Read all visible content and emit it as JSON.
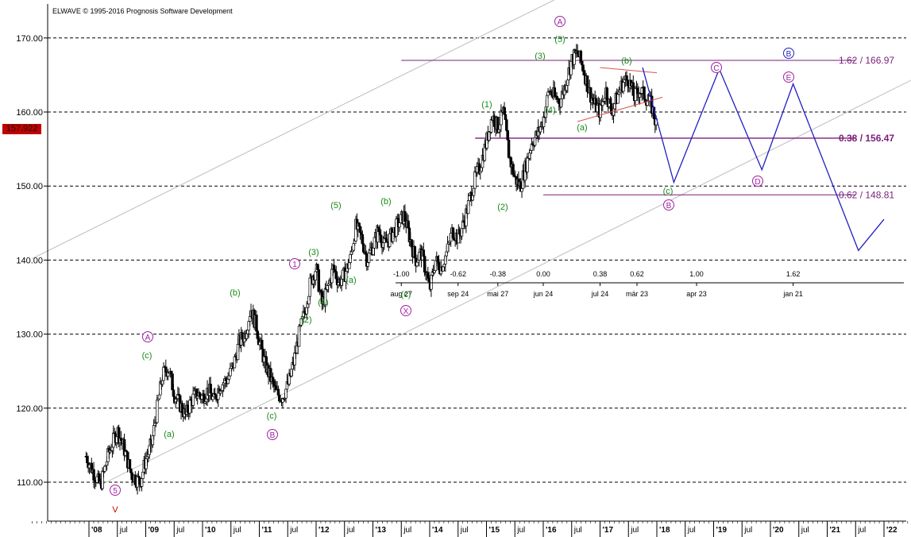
{
  "header": {
    "copyright": "ELWAVE © 1995-2016 Prognosis Software Development",
    "current_price": "157.922"
  },
  "chart_data": {
    "type": "candlestick",
    "title": "",
    "ylim": [
      104,
      176
    ],
    "y_ticks": [
      "110.00",
      "120.00",
      "130.00",
      "140.00",
      "150.00",
      "160.00",
      "170.00"
    ],
    "x_year_labels": [
      "'08",
      "'09",
      "'10",
      "'11",
      "'12",
      "'13",
      "'14",
      "'15",
      "'16",
      "'17",
      "'18",
      "'19",
      "'20",
      "'21",
      "'22"
    ],
    "x_month_labels": [
      "jul",
      "jul",
      "jul",
      "jul",
      "jul",
      "jul",
      "jul",
      "jul",
      "jul",
      "jul",
      "jul",
      "jul",
      "jul",
      "jul",
      "jul"
    ],
    "time_axis": {
      "ratios": [
        "-1.00",
        "-0.62",
        "-0.38",
        "0.00",
        "0.38",
        "0.62",
        "1.00",
        "1.62"
      ],
      "dates": [
        "aug 27",
        "sep 24",
        "mai 27",
        "jun 24",
        "jul 24",
        "mär 23",
        "apr 23",
        "jan 21"
      ]
    },
    "fib_levels": [
      {
        "label": "1.62 / 166.97",
        "value": 166.97,
        "bold": false
      },
      {
        "label": "0.38 / 156.47",
        "value": 156.47,
        "bold": true
      },
      {
        "label": "0.62 / 148.81",
        "value": 148.81,
        "bold": false
      }
    ],
    "wave_labels": [
      {
        "text": "5",
        "circle": true,
        "color": "purple"
      },
      {
        "text": "V",
        "circle": false,
        "color": "red"
      },
      {
        "text": "A",
        "circle": true,
        "color": "purple"
      },
      {
        "text": "c",
        "circle": false,
        "color": "green"
      },
      {
        "text": "a",
        "circle": false,
        "color": "green"
      },
      {
        "text": "b",
        "circle": false,
        "color": "green"
      },
      {
        "text": "c",
        "circle": false,
        "color": "green"
      },
      {
        "text": "B",
        "circle": true,
        "color": "purple"
      },
      {
        "text": "1",
        "circle": true,
        "color": "purple"
      },
      {
        "text": "3",
        "circle": false,
        "color": "green"
      },
      {
        "text": "2",
        "circle": false,
        "color": "green"
      },
      {
        "text": "4",
        "circle": false,
        "color": "green"
      },
      {
        "text": "5",
        "circle": false,
        "color": "green"
      },
      {
        "text": "a",
        "circle": false,
        "color": "green"
      },
      {
        "text": "b",
        "circle": false,
        "color": "green"
      },
      {
        "text": "c",
        "circle": false,
        "color": "green"
      },
      {
        "text": "X",
        "circle": true,
        "color": "purple"
      },
      {
        "text": "1",
        "circle": false,
        "color": "green"
      },
      {
        "text": "2",
        "circle": false,
        "color": "green"
      },
      {
        "text": "3",
        "circle": false,
        "color": "green"
      },
      {
        "text": "4",
        "circle": false,
        "color": "green"
      },
      {
        "text": "5",
        "circle": false,
        "color": "green"
      },
      {
        "text": "A",
        "circle": true,
        "color": "purple"
      },
      {
        "text": "a",
        "circle": false,
        "color": "green"
      },
      {
        "text": "b",
        "circle": false,
        "color": "green"
      },
      {
        "text": "c",
        "circle": false,
        "color": "green"
      },
      {
        "text": "B",
        "circle": true,
        "color": "purple"
      },
      {
        "text": "C",
        "circle": true,
        "color": "purple"
      },
      {
        "text": "D",
        "circle": true,
        "color": "purple"
      },
      {
        "text": "E",
        "circle": true,
        "color": "purple"
      },
      {
        "text": "B",
        "circle": true,
        "color": "blue"
      }
    ],
    "candle_path": [
      [
        2007.95,
        113.5
      ],
      [
        2008.1,
        111
      ],
      [
        2008.2,
        109.5
      ],
      [
        2008.35,
        114
      ],
      [
        2008.5,
        117
      ],
      [
        2008.6,
        115
      ],
      [
        2008.75,
        111
      ],
      [
        2008.9,
        110
      ],
      [
        2009.0,
        113
      ],
      [
        2009.1,
        115
      ],
      [
        2009.2,
        120
      ],
      [
        2009.3,
        124.5
      ],
      [
        2009.4,
        125.5
      ],
      [
        2009.5,
        122
      ],
      [
        2009.6,
        120.5
      ],
      [
        2009.7,
        119
      ],
      [
        2009.8,
        121
      ],
      [
        2009.9,
        122
      ],
      [
        2010.0,
        121.5
      ],
      [
        2010.1,
        122.5
      ],
      [
        2010.2,
        121
      ],
      [
        2010.3,
        123
      ],
      [
        2010.45,
        124
      ],
      [
        2010.55,
        126
      ],
      [
        2010.65,
        129
      ],
      [
        2010.75,
        130
      ],
      [
        2010.85,
        133.5
      ],
      [
        2010.95,
        131
      ],
      [
        2011.0,
        129
      ],
      [
        2011.1,
        126
      ],
      [
        2011.2,
        124
      ],
      [
        2011.3,
        122
      ],
      [
        2011.4,
        121.5
      ],
      [
        2011.5,
        123
      ],
      [
        2011.6,
        126
      ],
      [
        2011.7,
        130
      ],
      [
        2011.8,
        133
      ],
      [
        2011.9,
        137
      ],
      [
        2012.0,
        139
      ],
      [
        2012.1,
        134
      ],
      [
        2012.2,
        136
      ],
      [
        2012.3,
        139
      ],
      [
        2012.4,
        137
      ],
      [
        2012.5,
        138
      ],
      [
        2012.6,
        140
      ],
      [
        2012.7,
        144.5
      ],
      [
        2012.8,
        143
      ],
      [
        2012.9,
        140
      ],
      [
        2013.0,
        142
      ],
      [
        2013.1,
        144
      ],
      [
        2013.2,
        142
      ],
      [
        2013.3,
        143
      ],
      [
        2013.45,
        145
      ],
      [
        2013.55,
        146
      ],
      [
        2013.65,
        143
      ],
      [
        2013.75,
        140
      ],
      [
        2013.85,
        141
      ],
      [
        2013.95,
        138
      ],
      [
        2014.0,
        136
      ],
      [
        2014.1,
        140
      ],
      [
        2014.2,
        139
      ],
      [
        2014.3,
        141
      ],
      [
        2014.4,
        144
      ],
      [
        2014.5,
        143
      ],
      [
        2014.6,
        145
      ],
      [
        2014.7,
        148
      ],
      [
        2014.8,
        151
      ],
      [
        2014.9,
        153
      ],
      [
        2015.0,
        156
      ],
      [
        2015.1,
        159.5
      ],
      [
        2015.2,
        158
      ],
      [
        2015.3,
        160
      ],
      [
        2015.4,
        154
      ],
      [
        2015.5,
        151
      ],
      [
        2015.6,
        150
      ],
      [
        2015.7,
        153
      ],
      [
        2015.8,
        156
      ],
      [
        2015.9,
        157
      ],
      [
        2016.0,
        159
      ],
      [
        2016.1,
        163
      ],
      [
        2016.2,
        162
      ],
      [
        2016.3,
        161.5
      ],
      [
        2016.4,
        164
      ],
      [
        2016.5,
        167
      ],
      [
        2016.6,
        168
      ],
      [
        2016.7,
        166
      ],
      [
        2016.8,
        163
      ],
      [
        2016.9,
        161
      ],
      [
        2017.0,
        160
      ],
      [
        2017.1,
        163
      ],
      [
        2017.2,
        160
      ],
      [
        2017.3,
        162
      ],
      [
        2017.4,
        164
      ],
      [
        2017.5,
        164.5
      ],
      [
        2017.6,
        162
      ],
      [
        2017.7,
        163
      ],
      [
        2017.8,
        162
      ],
      [
        2017.9,
        161
      ],
      [
        2018.0,
        158
      ]
    ],
    "projection_path": [
      [
        2017.75,
        166
      ],
      [
        2018.3,
        150.5
      ],
      [
        2019.1,
        165.8
      ],
      [
        2019.85,
        152.2
      ],
      [
        2020.4,
        163.8
      ],
      [
        2021.55,
        141.3
      ],
      [
        2022.0,
        145.5
      ]
    ]
  }
}
